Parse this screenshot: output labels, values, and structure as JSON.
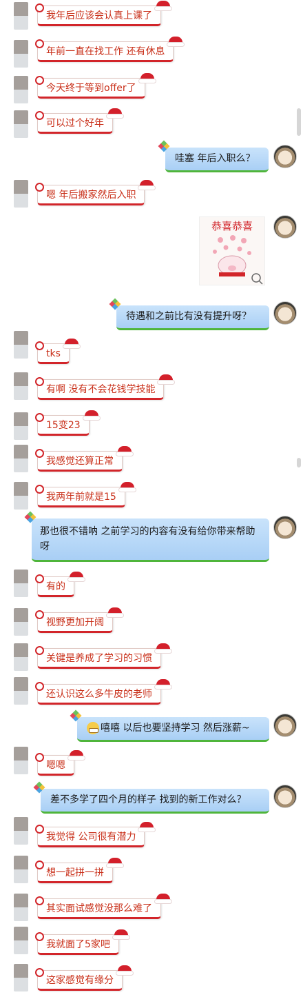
{
  "messages": [
    {
      "side": "left",
      "text": "我年后应该会认真上课了"
    },
    {
      "side": "left",
      "text": "年前一直在找工作  还有休息"
    },
    {
      "side": "left",
      "text": "今天终于等到offer了"
    },
    {
      "side": "left",
      "text": "可以过个好年"
    },
    {
      "side": "right",
      "text": "哇塞  年后入职么？"
    },
    {
      "side": "left",
      "text": "嗯  年后搬家然后入职"
    },
    {
      "side": "right",
      "sticker": "恭喜恭喜"
    },
    {
      "side": "right",
      "text": "待遇和之前比有没有提升呀？"
    },
    {
      "side": "left",
      "text": "tks"
    },
    {
      "side": "left",
      "text": "有啊  没有不会花钱学技能"
    },
    {
      "side": "left",
      "text": "15变23"
    },
    {
      "side": "left",
      "text": "我感觉还算正常"
    },
    {
      "side": "left",
      "text": "我两年前就是15"
    },
    {
      "side": "right",
      "text": "那也很不错呐 之前学习的内容有没有给你带来帮助呀"
    },
    {
      "side": "left",
      "text": "有的"
    },
    {
      "side": "left",
      "text": "视野更加开阔"
    },
    {
      "side": "left",
      "text": "关键是养成了学习的习惯"
    },
    {
      "side": "left",
      "text": "还认识这么多牛皮的老师"
    },
    {
      "side": "right",
      "text": "嘻嘻 以后也要坚持学习 然后涨薪~",
      "emoji": "grin-emoji"
    },
    {
      "side": "left",
      "text": "嗯嗯"
    },
    {
      "side": "right",
      "text": "差不多学了四个月的样子 找到的新工作对么？"
    },
    {
      "side": "left",
      "text": "我觉得  公司很有潜力"
    },
    {
      "side": "left",
      "text": "想一起拼一拼"
    },
    {
      "side": "left",
      "text": "其实面试感觉没那么难了"
    },
    {
      "side": "left",
      "text": "我就面了5家吧"
    },
    {
      "side": "left",
      "text": "这家感觉有缘分"
    }
  ],
  "colors": {
    "left_text": "#c9301a",
    "left_border": "#d2252a",
    "right_bubble": "#b9daf8",
    "right_underline": "#4fb53b"
  }
}
